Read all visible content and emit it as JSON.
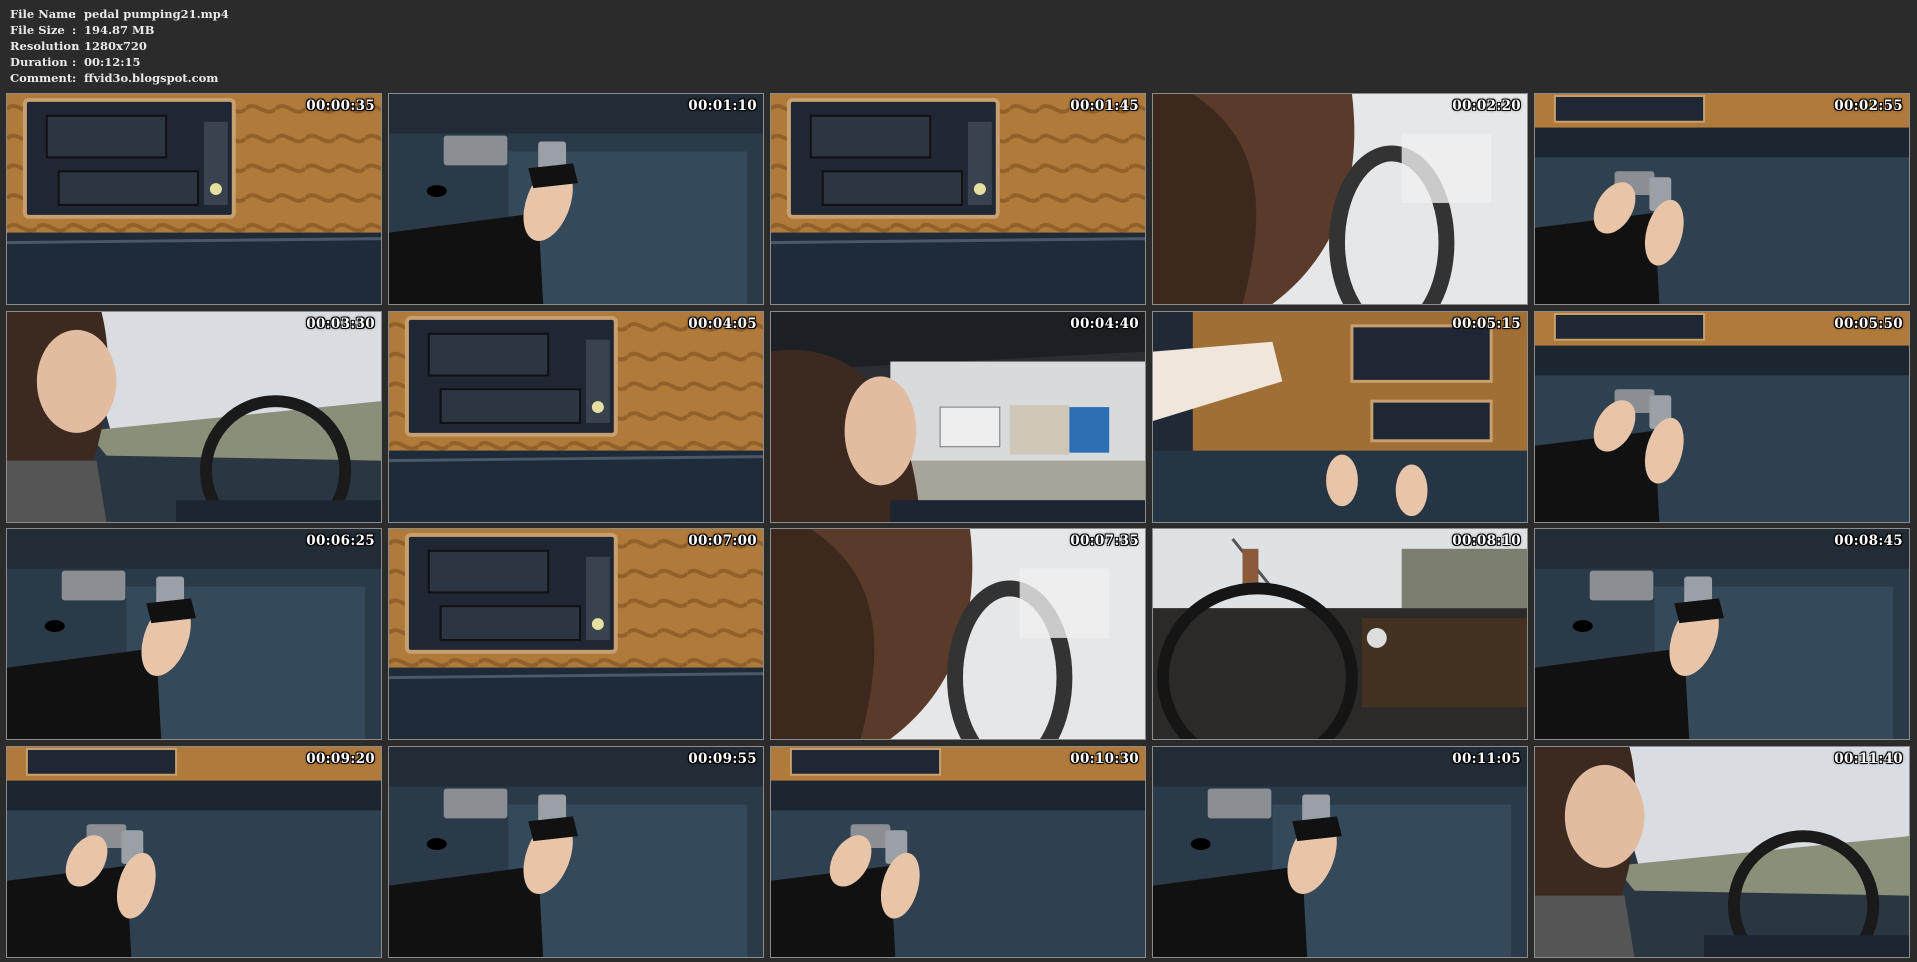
{
  "info": {
    "file_name": {
      "label": "File Name",
      "sep": ":",
      "value": "pedal pumping21.mp4"
    },
    "file_size": {
      "label": "File Size",
      "sep": ":",
      "value": "194.87 MB"
    },
    "resolution": {
      "label": "Resolution",
      "sep": ":",
      "value": "1280x720"
    },
    "duration": {
      "label": "Duration",
      "sep": ":",
      "value": "00:12:15"
    },
    "comment": {
      "label": "Comment",
      "sep": ":",
      "value": "ffvid3o.blogspot.com"
    }
  },
  "thumbnails": [
    {
      "time": "00:00:35",
      "scene": "dash-console"
    },
    {
      "time": "00:01:10",
      "scene": "pedals"
    },
    {
      "time": "00:01:45",
      "scene": "dash-console"
    },
    {
      "time": "00:02:20",
      "scene": "driver-hair"
    },
    {
      "time": "00:02:55",
      "scene": "dash-pedals"
    },
    {
      "time": "00:03:30",
      "scene": "driver-profile"
    },
    {
      "time": "00:04:05",
      "scene": "dash-console"
    },
    {
      "time": "00:04:40",
      "scene": "driver-window"
    },
    {
      "time": "00:05:15",
      "scene": "dash-hand"
    },
    {
      "time": "00:05:50",
      "scene": "dash-pedals"
    },
    {
      "time": "00:06:25",
      "scene": "pedals"
    },
    {
      "time": "00:07:00",
      "scene": "dash-console"
    },
    {
      "time": "00:07:35",
      "scene": "driver-hair"
    },
    {
      "time": "00:08:10",
      "scene": "wheel-view"
    },
    {
      "time": "00:08:45",
      "scene": "pedals"
    },
    {
      "time": "00:09:20",
      "scene": "dash-pedals"
    },
    {
      "time": "00:09:55",
      "scene": "pedals"
    },
    {
      "time": "00:10:30",
      "scene": "dash-pedals"
    },
    {
      "time": "00:11:05",
      "scene": "pedals"
    },
    {
      "time": "00:11:40",
      "scene": "driver-profile"
    }
  ],
  "colors": {
    "background": "#2b2b2b",
    "text": "#e9e9e9",
    "thumb_border": "#8c8c8c"
  }
}
